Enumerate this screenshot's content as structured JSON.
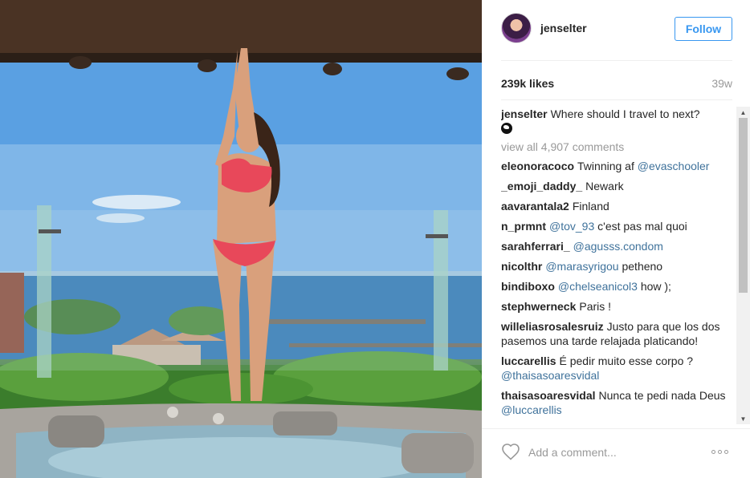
{
  "post": {
    "username": "jenselter",
    "follow_label": "Follow",
    "likes": "239k likes",
    "age": "39w",
    "caption_user": "jenselter",
    "caption_text": "Where should I travel to next?",
    "view_all": "view all 4,907 comments",
    "add_comment_placeholder": "Add a comment..."
  },
  "comments": [
    {
      "user": "eleonoracoco",
      "pre": "Twinning af ",
      "mention": "@evaschooler",
      "post": ""
    },
    {
      "user": "_emoji_daddy_",
      "pre": "Newark",
      "mention": "",
      "post": ""
    },
    {
      "user": "aavarantala2",
      "pre": "Finland",
      "mention": "",
      "post": ""
    },
    {
      "user": "n_prmnt",
      "pre": "",
      "mention": "@tov_93",
      "post": " c'est pas mal quoi"
    },
    {
      "user": "sarahferrari_",
      "pre": "",
      "mention": "@agusss.condom",
      "post": ""
    },
    {
      "user": "nicolthr",
      "pre": "",
      "mention": "@marasyrigou",
      "post": " petheno"
    },
    {
      "user": "bindiboxo",
      "pre": "",
      "mention": "@chelseanicol3",
      "post": " how );"
    },
    {
      "user": "stephwerneck",
      "pre": "Paris !",
      "mention": "",
      "post": ""
    },
    {
      "user": "willeliasrosalesruiz",
      "pre": "Justo para que los dos pasemos una tarde relajada platicando!",
      "mention": "",
      "post": ""
    },
    {
      "user": "luccarellis",
      "pre": "É pedir muito esse corpo ? ",
      "mention": "@thaisasoaresvidal",
      "post": ""
    },
    {
      "user": "thaisasoaresvidal",
      "pre": "Nunca te pedi nada Deus ",
      "mention": "@luccarellis",
      "post": ""
    }
  ],
  "icons": {
    "heart": "heart-outline-icon",
    "more": "more-options-icon",
    "globe": "globe-emoji-icon"
  },
  "colors": {
    "accent": "#3897f0",
    "mention": "#3f729b",
    "muted": "#999999"
  }
}
